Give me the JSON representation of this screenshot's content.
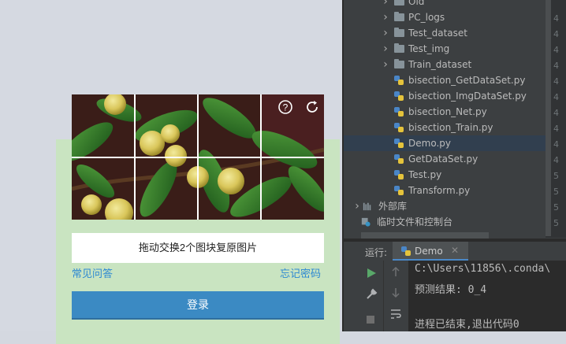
{
  "captcha": {
    "header_text": "",
    "instruction": "拖动交换2个图块复原图片",
    "faq_link": "常见问答",
    "forgot_link": "忘记密码",
    "login_button": "登录",
    "help_icon": "help-circle-icon",
    "refresh_icon": "refresh-icon"
  },
  "project_tree": {
    "items": [
      {
        "label": "Old",
        "kind": "folder",
        "expandable": true,
        "depth": 1
      },
      {
        "label": "PC_logs",
        "kind": "folder",
        "expandable": true,
        "depth": 1
      },
      {
        "label": "Test_dataset",
        "kind": "folder",
        "expandable": true,
        "depth": 1
      },
      {
        "label": "Test_img",
        "kind": "folder",
        "expandable": true,
        "depth": 1
      },
      {
        "label": "Train_dataset",
        "kind": "folder",
        "expandable": true,
        "depth": 1
      },
      {
        "label": "bisection_GetDataSet.py",
        "kind": "python",
        "depth": 2
      },
      {
        "label": "bisection_ImgDataSet.py",
        "kind": "python",
        "depth": 2
      },
      {
        "label": "bisection_Net.py",
        "kind": "python",
        "depth": 2
      },
      {
        "label": "bisection_Train.py",
        "kind": "python",
        "depth": 2
      },
      {
        "label": "Demo.py",
        "kind": "python",
        "depth": 2,
        "selected": true
      },
      {
        "label": "GetDataSet.py",
        "kind": "python",
        "depth": 2
      },
      {
        "label": "Test.py",
        "kind": "python",
        "depth": 2
      },
      {
        "label": "Transform.py",
        "kind": "python",
        "depth": 2
      },
      {
        "label": "外部库",
        "kind": "library",
        "expandable": true,
        "depth": 0
      },
      {
        "label": "临时文件和控制台",
        "kind": "scratch",
        "depth": 0
      }
    ],
    "gutter_numbers": [
      "4",
      "4",
      "4",
      "4",
      "4",
      "4",
      "4",
      "4",
      "4",
      "4",
      "5",
      "5",
      "5",
      "5"
    ]
  },
  "run_panel": {
    "label": "运行:",
    "tab_name": "Demo",
    "console_lines": [
      "C:\\Users\\11856\\.conda\\",
      "预测结果: 0_4",
      "",
      "进程已结束,退出代码0"
    ]
  },
  "colors": {
    "accent": "#3b8ac3",
    "link": "#2d88d2",
    "panel_green": "#c9e4c1",
    "ide_bg": "#3c3f41",
    "console_bg": "#2b2b2b"
  }
}
